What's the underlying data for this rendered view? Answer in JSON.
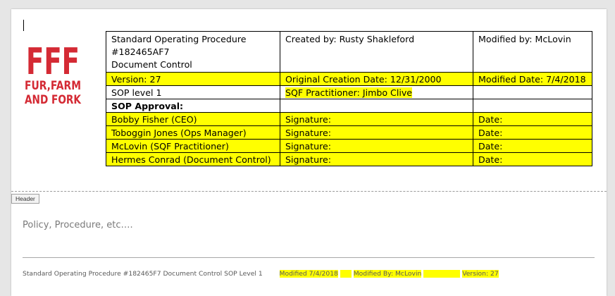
{
  "logo": {
    "big_letters": "FFF",
    "line1": "FUR,FARM",
    "line2": "AND FORK",
    "color": "#d42a34"
  },
  "table": {
    "header_row": {
      "title_line1": "Standard Operating Procedure",
      "title_line2": "#182465AF7",
      "title_line3": "Document Control",
      "created_by": "Created by: Rusty Shakleford",
      "modified_by": "Modified by: McLovin"
    },
    "row_version": {
      "version": "Version: 27",
      "original_creation_date": "Original Creation Date: 12/31/2000",
      "modified_date": "Modified Date: 7/4/2018"
    },
    "row_level": {
      "level": "SOP level 1",
      "practitioner": "SQF Practitioner: Jimbo Clive"
    },
    "approval_heading": "SOP Approval:",
    "approvers": [
      {
        "name": "Bobby Fisher (CEO)",
        "signature": "Signature:",
        "date": "Date:"
      },
      {
        "name": "Toboggin Jones (Ops Manager)",
        "signature": "Signature:",
        "date": "Date:"
      },
      {
        "name": "McLovin (SQF Practitioner)",
        "signature": "Signature:",
        "date": "Date:"
      },
      {
        "name": "Hermes Conrad (Document Control)",
        "signature": "Signature:",
        "date": "Date:"
      }
    ]
  },
  "header_tag": "Header",
  "body_text": "Policy, Procedure, etc….",
  "footer": {
    "title": "Standard Operating Procedure #182465F7 Document Control SOP Level 1",
    "modified": "Modified 7/4/2018",
    "modified_by": "Modified By: McLovin",
    "version": "Version: 27"
  },
  "colors": {
    "highlight": "#ffff00",
    "spellcheck": "#dd3333"
  }
}
